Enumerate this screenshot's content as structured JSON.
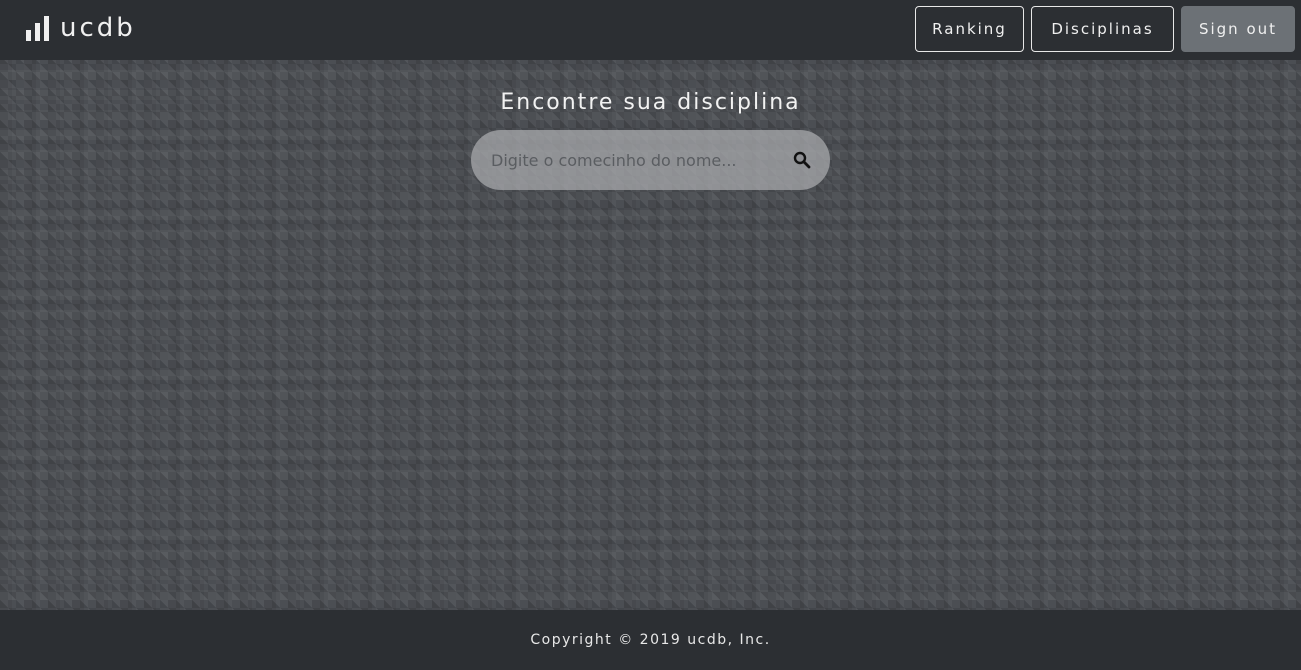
{
  "header": {
    "brand_name": "ucdb",
    "brand_icon": "bar-chart-icon",
    "nav": {
      "ranking_label": "Ranking",
      "disciplinas_label": "Disciplinas",
      "signout_label": "Sign out"
    }
  },
  "main": {
    "title": "Encontre sua disciplina",
    "search": {
      "value": "",
      "placeholder": "Digite o comecinho do nome...",
      "icon": "search-icon"
    }
  },
  "footer": {
    "copyright": "Copyright © 2019 ucdb, Inc."
  },
  "colors": {
    "bar_background": "#2c2f33",
    "page_background": "#4b4e53",
    "signout_background": "#6c7176"
  }
}
